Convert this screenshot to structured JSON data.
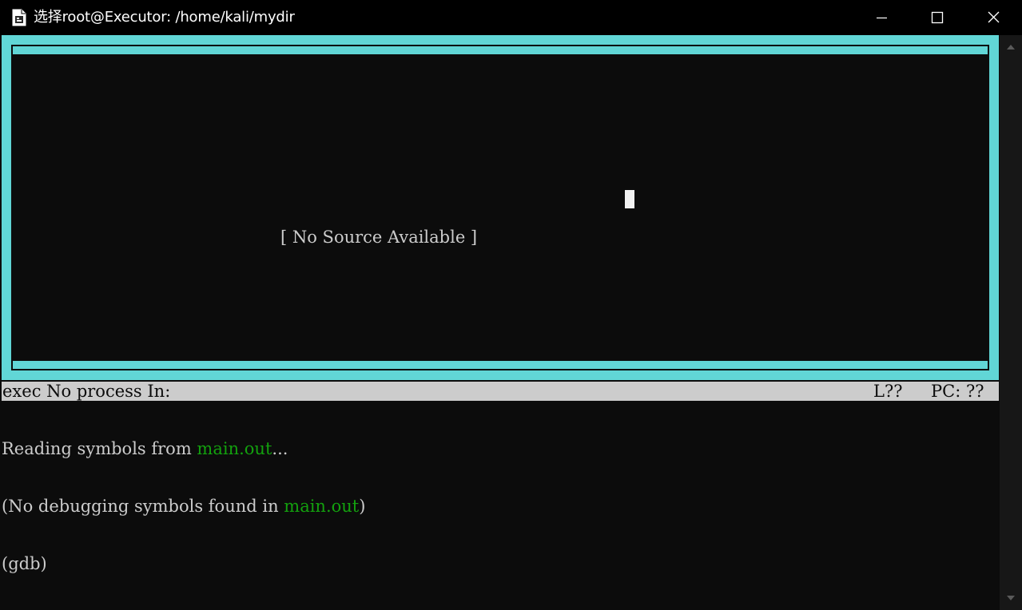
{
  "window": {
    "title": "选择root@Executor: /home/kali/mydir",
    "app_icon": "terminal-app-icon",
    "controls": {
      "minimize_icon": "minimize-icon",
      "maximize_icon": "maximize-icon",
      "close_icon": "close-icon"
    }
  },
  "source_window": {
    "message": "[ No Source Available ]"
  },
  "status_bar": {
    "left": "exec No process In:",
    "line": "L??",
    "pc": "PC: ??"
  },
  "console": {
    "line1_prefix": "Reading symbols from ",
    "line1_file": "main.out",
    "line1_suffix": "...",
    "line2_prefix": "(No debugging symbols found in ",
    "line2_file": "main.out",
    "line2_suffix": ")",
    "prompt": "(gdb)"
  },
  "colors": {
    "frame_cyan": "#61d6d6",
    "background": "#0c0c0c",
    "text": "#cccccc",
    "filename_green": "#13a10e",
    "status_bar_bg": "#cccccc"
  },
  "scrollbar": {
    "up_icon": "scroll-up-arrow-icon",
    "down_icon": "scroll-down-arrow-icon"
  }
}
